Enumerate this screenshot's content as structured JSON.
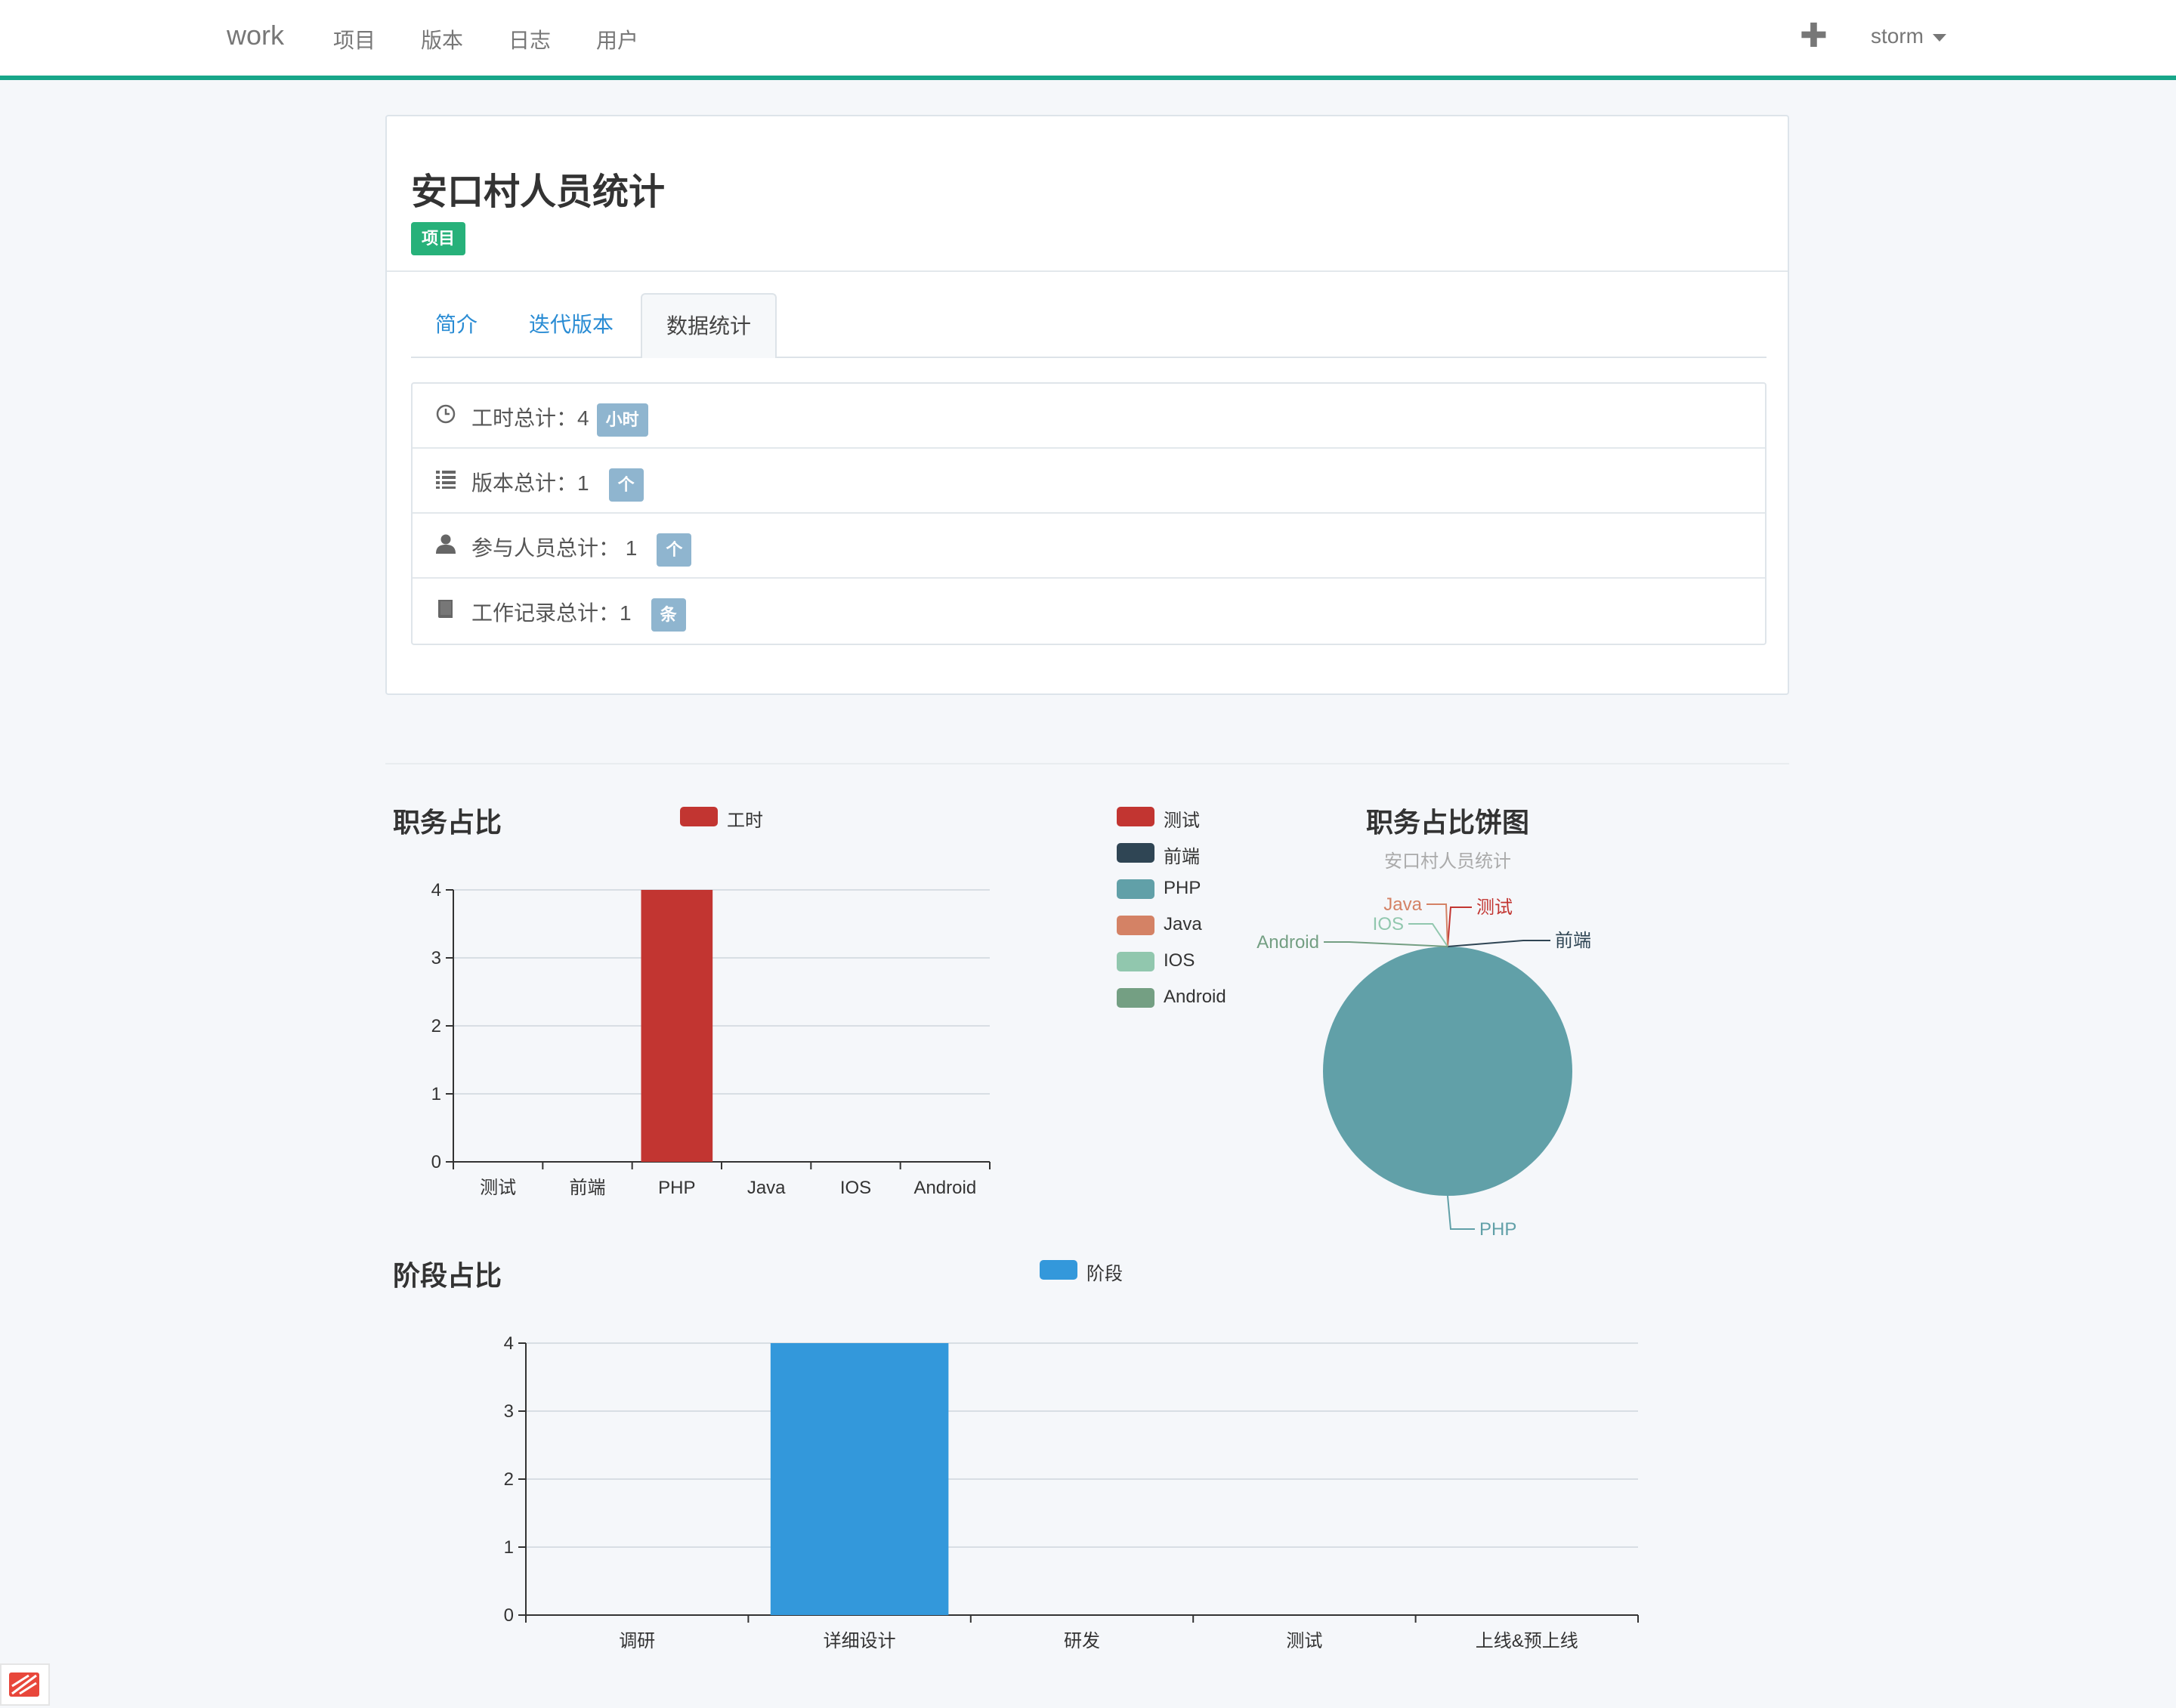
{
  "navbar": {
    "brand": "work",
    "items": [
      "项目",
      "版本",
      "日志",
      "用户"
    ],
    "add_icon": "plus-icon",
    "user": "storm"
  },
  "project": {
    "title": "安口村人员统计",
    "badge": "项目",
    "tabs": [
      {
        "label": "简介",
        "active": false
      },
      {
        "label": "迭代版本",
        "active": false
      },
      {
        "label": "数据统计",
        "active": true
      }
    ],
    "stats": [
      {
        "icon": "clock-icon",
        "text": "工时总计：4",
        "unit": "小时"
      },
      {
        "icon": "list-icon",
        "text": "版本总计：1",
        "unit": "个"
      },
      {
        "icon": "user-icon",
        "text": "参与人员总计： 1",
        "unit": "个"
      },
      {
        "icon": "book-icon",
        "text": "工作记录总计：1",
        "unit": "条"
      }
    ]
  },
  "colors": {
    "accent": "#18a689",
    "badge_green": "#27b17a",
    "unit_badge": "#8fb5cf",
    "link": "#2a8cd4"
  },
  "chart_data": [
    {
      "type": "bar",
      "title": "职务占比",
      "series": [
        {
          "name": "工时",
          "color": "#c23531",
          "values": [
            0,
            0,
            4,
            0,
            0,
            0
          ]
        }
      ],
      "categories": [
        "测试",
        "前端",
        "PHP",
        "Java",
        "IOS",
        "Android"
      ],
      "ylim": [
        0,
        4
      ],
      "yticks": [
        0,
        1,
        2,
        3,
        4
      ],
      "grid": true,
      "legend": "top"
    },
    {
      "type": "pie",
      "title": "职务占比饼图",
      "subtitle": "安口村人员统计",
      "labels": [
        "测试",
        "前端",
        "PHP",
        "Java",
        "IOS",
        "Android"
      ],
      "values": [
        0,
        0,
        4,
        0,
        0,
        0
      ],
      "colors": [
        "#c23531",
        "#2f4554",
        "#61a0a8",
        "#d48265",
        "#91c7ae",
        "#749f83"
      ],
      "legend": "left"
    },
    {
      "type": "bar",
      "title": "阶段占比",
      "series": [
        {
          "name": "阶段",
          "color": "#3398db",
          "values": [
            0,
            4,
            0,
            0,
            0
          ]
        }
      ],
      "categories": [
        "调研",
        "详细设计",
        "研发",
        "测试",
        "上线&预上线"
      ],
      "ylim": [
        0,
        4
      ],
      "yticks": [
        0,
        1,
        2,
        3,
        4
      ],
      "grid": true,
      "legend": "top"
    }
  ]
}
